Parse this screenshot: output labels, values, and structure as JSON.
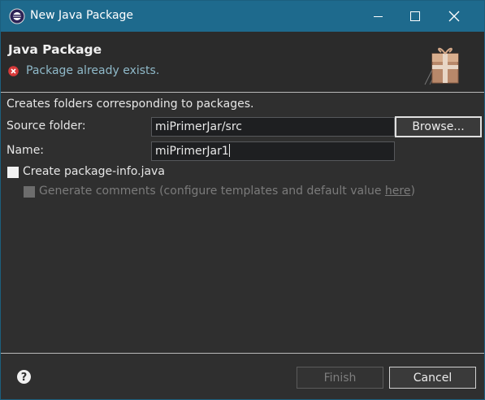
{
  "window": {
    "title": "New Java Package"
  },
  "header": {
    "title": "Java Package",
    "message": "Package already exists.",
    "message_icon": "error-icon",
    "image_icon": "package-wizard-icon"
  },
  "form": {
    "description": "Creates folders corresponding to packages.",
    "source_folder_label": "Source folder:",
    "source_folder_value": "miPrimerJar/src",
    "browse_label": "Browse...",
    "name_label": "Name:",
    "name_value": "miPrimerJar1",
    "create_package_info": {
      "label": "Create package-info.java",
      "checked": false
    },
    "generate_comments": {
      "label_prefix": "Generate comments (configure templates and default value ",
      "link_text": "here",
      "label_suffix": ")",
      "checked": false,
      "enabled": false
    }
  },
  "footer": {
    "finish_label": "Finish",
    "cancel_label": "Cancel",
    "help_icon": "help-icon"
  },
  "colors": {
    "titlebar": "#1e6a8d",
    "background": "#2f2f2f",
    "message": "#8fb9c9",
    "error": "#d83a3a"
  }
}
